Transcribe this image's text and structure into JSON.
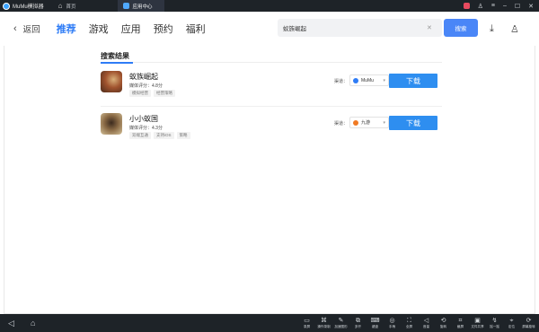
{
  "titlebar": {
    "app_title": "MuMu模拟器",
    "home_tab": "首页",
    "active_tab": "应用中心"
  },
  "nav": {
    "back_label": "返回",
    "tabs": [
      {
        "label": "推荐",
        "active": true
      },
      {
        "label": "游戏",
        "active": false
      },
      {
        "label": "应用",
        "active": false
      },
      {
        "label": "预约",
        "active": false
      },
      {
        "label": "福利",
        "active": false
      }
    ],
    "search_value": "蚁族崛起",
    "search_button": "搜索"
  },
  "results": {
    "title": "搜索结果",
    "items": [
      {
        "name": "蚁族崛起",
        "rating": "媒体评分：4.8分",
        "tags": [
          "模拟经营",
          "经营策略"
        ],
        "channel_label": "渠道：",
        "channel": "MuMu",
        "download": "下载"
      },
      {
        "name": "小小蚁国",
        "rating": "媒体评分：4.3分",
        "tags": [
          "双端互通",
          "支持iOS",
          "策略"
        ],
        "channel_label": "渠道：",
        "channel": "九游",
        "download": "下载"
      }
    ]
  },
  "toolbar": {
    "tools": [
      {
        "label": "录屏",
        "icon": "record-icon"
      },
      {
        "label": "操作录制",
        "icon": "macro-icon"
      },
      {
        "label": "加速图形",
        "icon": "boost-icon"
      },
      {
        "label": "多开",
        "icon": "multi-icon"
      },
      {
        "label": "键盘",
        "icon": "keyboard-icon"
      },
      {
        "label": "手柄",
        "icon": "gamepad-icon"
      },
      {
        "label": "全屏",
        "icon": "fullscreen-icon"
      },
      {
        "label": "音量",
        "icon": "volume-icon"
      },
      {
        "label": "旋转",
        "icon": "rotate-icon"
      },
      {
        "label": "截屏",
        "icon": "screenshot-icon"
      },
      {
        "label": "文件共享",
        "icon": "share-icon"
      },
      {
        "label": "摇一摇",
        "icon": "shake-icon"
      },
      {
        "label": "定位",
        "icon": "location-icon"
      },
      {
        "label": "屏幕旋转",
        "icon": "screen-rotate-icon"
      }
    ]
  }
}
